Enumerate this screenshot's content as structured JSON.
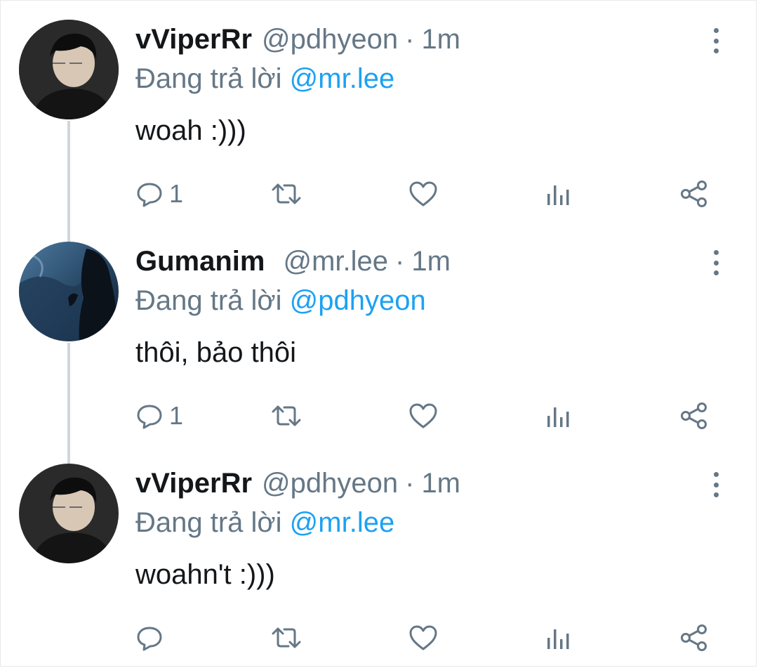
{
  "tweets": [
    {
      "name": "vViperRr",
      "handle": "@pdhyeon",
      "separator": "·",
      "time": "1m",
      "reply_prefix": "Đang trả lời",
      "reply_to": "@mr.lee",
      "text": "woah :)))",
      "reply_count": "1",
      "avatar": "person-avatar"
    },
    {
      "name": "Gumanim",
      "handle": "@mr.lee",
      "separator": "·",
      "time": "1m",
      "reply_prefix": "Đang trả lời",
      "reply_to": "@pdhyeon",
      "text": "thôi, bảo thôi",
      "reply_count": "1",
      "avatar": "landscape-avatar"
    },
    {
      "name": "vViperRr",
      "handle": "@pdhyeon",
      "separator": "·",
      "time": "1m",
      "reply_prefix": "Đang trả lời",
      "reply_to": "@mr.lee",
      "text": "woahn't :)))",
      "reply_count": "",
      "avatar": "person-avatar"
    }
  ],
  "icons": {
    "reply": "reply-icon",
    "retweet": "retweet-icon",
    "like": "like-icon",
    "analytics": "analytics-icon",
    "share": "share-icon",
    "more": "more-options-icon"
  },
  "colors": {
    "text": "#14171a",
    "muted": "#657786",
    "mention": "#1da1f2",
    "thread_line": "#cfd6dc"
  }
}
